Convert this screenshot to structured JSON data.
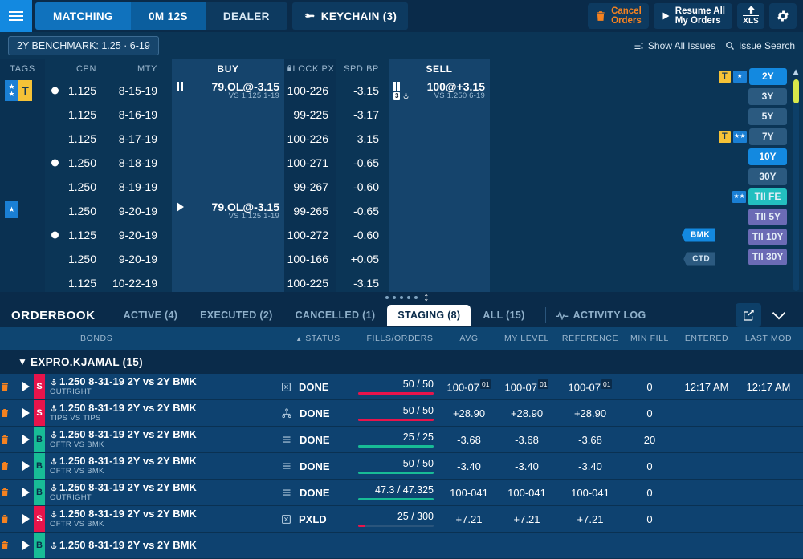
{
  "topbar": {
    "menu_icon": "hamburger-icon",
    "modes": [
      {
        "label": "MATCHING",
        "state": "active"
      },
      {
        "label": "0M 12S",
        "state": "timer"
      },
      {
        "label": "DEALER",
        "state": "inactive"
      }
    ],
    "keychain_label": "KEYCHAIN (3)",
    "keychain_icon": "key-icon",
    "cancel_orders": {
      "line1": "Cancel",
      "line2": "Orders",
      "icon": "trash-icon"
    },
    "resume_orders": {
      "line1": "Resume All",
      "line2": "My Orders",
      "icon": "play-icon"
    },
    "xls": {
      "label": "XLS",
      "icon": "upload-icon"
    },
    "settings_icon": "gear-icon"
  },
  "blotter": {
    "benchmark": "2Y BENCHMARK: 1.25 · 6-19",
    "show_all_issues": "Show All Issues",
    "issue_search": "Issue Search",
    "headers": {
      "tags": "TAGS",
      "cpn": "CPN",
      "mty": "MTY",
      "buy": "BUY",
      "lock_px": "LOCK PX",
      "spd_bp": "SPD BP",
      "sell": "SELL"
    },
    "rows": [
      {
        "tags": "star2-t",
        "dot": true,
        "cpn": "1.125",
        "mty": "8-15-19",
        "buy": {
          "icon": "pause-icon",
          "q1": "79.OL@-3.15",
          "q2": "VS 1.125 1-19"
        },
        "lock": "100-226",
        "spd": "-3.15",
        "sell": {
          "icon": "pause-icon",
          "badge": "3",
          "anchor": true,
          "q1": "100@+3.15",
          "q2": "VS 1.250 6-19"
        },
        "flag": null
      },
      {
        "tags": null,
        "dot": false,
        "cpn": "1.125",
        "mty": "8-16-19",
        "buy": null,
        "lock": "99-225",
        "spd": "-3.17",
        "sell": null,
        "flag": null
      },
      {
        "tags": null,
        "dot": false,
        "cpn": "1.125",
        "mty": "8-17-19",
        "buy": null,
        "lock": "100-226",
        "spd": "3.15",
        "sell": null,
        "flag": null
      },
      {
        "tags": null,
        "dot": true,
        "cpn": "1.250",
        "mty": "8-18-19",
        "buy": null,
        "lock": "100-271",
        "spd": "-0.65",
        "sell": null,
        "flag": null
      },
      {
        "tags": null,
        "dot": false,
        "cpn": "1.250",
        "mty": "8-19-19",
        "buy": null,
        "lock": "99-267",
        "spd": "-0.60",
        "sell": null,
        "flag": null
      },
      {
        "tags": "star1",
        "dot": false,
        "cpn": "1.250",
        "mty": "9-20-19",
        "buy": {
          "icon": "play-icon",
          "q1": "79.OL@-3.15",
          "q2": "VS 1.125 1-19"
        },
        "lock": "99-265",
        "spd": "-0.65",
        "sell": null,
        "flag": null
      },
      {
        "tags": null,
        "dot": true,
        "cpn": "1.125",
        "mty": "9-20-19",
        "buy": null,
        "lock": "100-272",
        "spd": "-0.60",
        "sell": null,
        "flag": "BMK"
      },
      {
        "tags": null,
        "dot": false,
        "cpn": "1.250",
        "mty": "9-20-19",
        "buy": null,
        "lock": "100-166",
        "spd": "+0.05",
        "sell": null,
        "flag": "CTD"
      },
      {
        "tags": null,
        "dot": false,
        "cpn": "1.125",
        "mty": "10-22-19",
        "buy": null,
        "lock": "100-225",
        "spd": "-3.15",
        "sell": null,
        "flag": null
      }
    ],
    "tenors": [
      {
        "label": "2Y",
        "style": "on",
        "t": true,
        "stars": 1
      },
      {
        "label": "3Y",
        "style": "off",
        "t": false,
        "stars": 0
      },
      {
        "label": "5Y",
        "style": "off",
        "t": false,
        "stars": 0
      },
      {
        "label": "7Y",
        "style": "off",
        "t": true,
        "stars": 2
      },
      {
        "label": "10Y",
        "style": "on",
        "t": false,
        "stars": 0
      },
      {
        "label": "30Y",
        "style": "off",
        "t": false,
        "stars": 0
      },
      {
        "label": "TII FE",
        "style": "tiife",
        "t": false,
        "stars": 2
      },
      {
        "label": "TII 5Y",
        "style": "tii",
        "t": false,
        "stars": 0
      },
      {
        "label": "TII 10Y",
        "style": "tii",
        "t": false,
        "stars": 0
      },
      {
        "label": "TII 30Y",
        "style": "tii",
        "t": false,
        "stars": 0
      }
    ]
  },
  "orderbook": {
    "title": "ORDERBOOK",
    "tabs": [
      {
        "label": "ACTIVE (4)",
        "active": false
      },
      {
        "label": "EXECUTED (2)",
        "active": false
      },
      {
        "label": "CANCELLED (1)",
        "active": false
      },
      {
        "label": "STAGING (8)",
        "active": true
      },
      {
        "label": "ALL (15)",
        "active": false
      }
    ],
    "activity_log": "ACTIVITY LOG",
    "popout_icon": "external-link-icon",
    "collapse_icon": "chevron-down-icon",
    "headers": {
      "bonds": "BONDS",
      "status": "STATUS",
      "fills_orders": "FILLS/ORDERS",
      "avg": "AVG",
      "my_level": "MY LEVEL",
      "reference": "REFERENCE",
      "min_fill": "MIN FILL",
      "entered": "ENTERED",
      "last_mod": "LAST MOD"
    },
    "group": "EXPRO.KJAMAL (15)",
    "rows": [
      {
        "side": "S",
        "bond": "1.250 8-31-19 2Y vs 2Y BMK",
        "sub": "OUTRIGHT",
        "status_icon": "boxed-x-icon",
        "status": "DONE",
        "fills": "50 / 50",
        "pct": 100,
        "avg": "100-07",
        "avg_sup": "01",
        "level": "100-07",
        "level_sup": "01",
        "ref": "100-07",
        "ref_sup": "01",
        "minfill": "0",
        "entered": "12:17 AM",
        "lastmod": "12:17 AM"
      },
      {
        "side": "S",
        "bond": "1.250 8-31-19 2Y vs 2Y BMK",
        "sub": "TIPS VS TIPS",
        "status_icon": "tree-icon",
        "status": "DONE",
        "fills": "50 / 50",
        "pct": 100,
        "avg": "+28.90",
        "level": "+28.90",
        "ref": "+28.90",
        "minfill": "0",
        "entered": "",
        "lastmod": ""
      },
      {
        "side": "B",
        "bond": "1.250 8-31-19 2Y vs 2Y BMK",
        "sub": "OFTR VS BMK",
        "status_icon": "list-icon",
        "status": "DONE",
        "fills": "25 / 25",
        "pct": 100,
        "avg": "-3.68",
        "level": "-3.68",
        "ref": "-3.68",
        "minfill": "20",
        "entered": "",
        "lastmod": ""
      },
      {
        "side": "B",
        "bond": "1.250 8-31-19 2Y vs 2Y BMK",
        "sub": "OFTR VS BMK",
        "status_icon": "list-icon",
        "status": "DONE",
        "fills": "50 / 50",
        "pct": 100,
        "avg": "-3.40",
        "level": "-3.40",
        "ref": "-3.40",
        "minfill": "0",
        "entered": "",
        "lastmod": ""
      },
      {
        "side": "B",
        "bond": "1.250 8-31-19 2Y vs 2Y BMK",
        "sub": "OUTRIGHT",
        "status_icon": "list-icon",
        "status": "DONE",
        "fills": "47.3 / 47.325",
        "pct": 100,
        "avg": "100-041",
        "level": "100-041",
        "ref": "100-041",
        "minfill": "0",
        "entered": "",
        "lastmod": ""
      },
      {
        "side": "S",
        "bond": "1.250 8-31-19 2Y vs 2Y BMK",
        "sub": "OFTR VS BMK",
        "status_icon": "boxed-x-icon",
        "status": "PXLD",
        "fills": "25 / 300",
        "pct": 8,
        "avg": "+7.21",
        "level": "+7.21",
        "ref": "+7.21",
        "minfill": "0",
        "entered": "",
        "lastmod": ""
      },
      {
        "side": "B",
        "bond": "1.250 8-31-19 2Y vs 2Y BMK",
        "sub": "",
        "status_icon": "boxed-x-icon",
        "status": "",
        "fills": "",
        "pct": 0,
        "avg": "",
        "level": "",
        "ref": "",
        "minfill": "",
        "entered": "",
        "lastmod": ""
      }
    ]
  },
  "colors": {
    "buy": "#18bc96",
    "sell": "#e8144b",
    "accent": "#1389e0",
    "orange": "#f58220",
    "gold": "#f5c237",
    "tii": "#6b6bb5"
  }
}
